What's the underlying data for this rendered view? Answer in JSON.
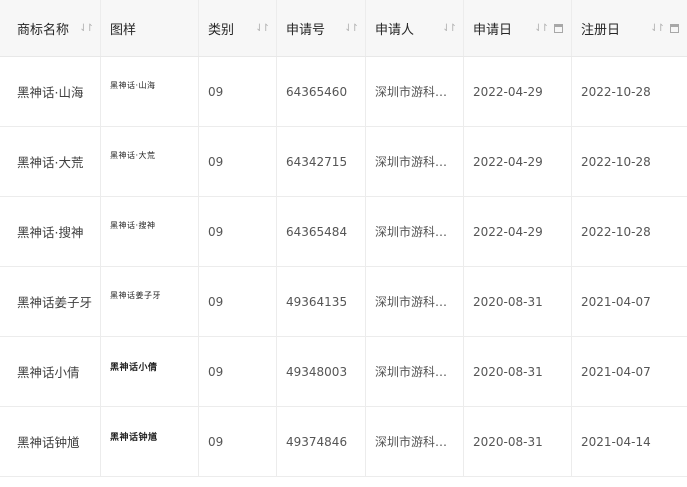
{
  "table": {
    "columns": [
      {
        "key": "name",
        "label": "商标名称",
        "sortable": true,
        "date_filter": false
      },
      {
        "key": "pattern",
        "label": "图样",
        "sortable": false,
        "date_filter": false
      },
      {
        "key": "class",
        "label": "类别",
        "sortable": true,
        "date_filter": false
      },
      {
        "key": "reg_no",
        "label": "申请号",
        "sortable": true,
        "date_filter": false
      },
      {
        "key": "applicant",
        "label": "申请人",
        "sortable": true,
        "date_filter": false
      },
      {
        "key": "apply_date",
        "label": "申请日",
        "sortable": true,
        "date_filter": true
      },
      {
        "key": "register_date",
        "label": "注册日",
        "sortable": true,
        "date_filter": true
      }
    ],
    "rows": [
      {
        "name": "黑神话·山海",
        "pattern": "黑神话·山海",
        "class": "09",
        "reg_no": "64365460",
        "applicant": "深圳市游科互…",
        "apply_date": "2022-04-29",
        "register_date": "2022-10-28"
      },
      {
        "name": "黑神话·大荒",
        "pattern": "黑神话·大荒",
        "class": "09",
        "reg_no": "64342715",
        "applicant": "深圳市游科互…",
        "apply_date": "2022-04-29",
        "register_date": "2022-10-28"
      },
      {
        "name": "黑神话·搜神",
        "pattern": "黑神话·搜神",
        "class": "09",
        "reg_no": "64365484",
        "applicant": "深圳市游科互…",
        "apply_date": "2022-04-29",
        "register_date": "2022-10-28"
      },
      {
        "name": "黑神话姜子牙",
        "pattern": "黑神话姜子牙",
        "class": "09",
        "reg_no": "49364135",
        "applicant": "深圳市游科互…",
        "apply_date": "2020-08-31",
        "register_date": "2021-04-07"
      },
      {
        "name": "黑神话小倩",
        "pattern": "黑神话小倩",
        "class": "09",
        "reg_no": "49348003",
        "applicant": "深圳市游科互…",
        "apply_date": "2020-08-31",
        "register_date": "2021-04-07"
      },
      {
        "name": "黑神话钟馗",
        "pattern": "黑神话钟馗",
        "class": "09",
        "reg_no": "49374846",
        "applicant": "深圳市游科互…",
        "apply_date": "2020-08-31",
        "register_date": "2021-04-14"
      }
    ]
  },
  "icons": {
    "sort": "sort-icon",
    "calendar": "calendar-icon"
  },
  "colors": {
    "header_bg": "#f7f7f7",
    "border": "#ececec",
    "text": "#555555"
  }
}
